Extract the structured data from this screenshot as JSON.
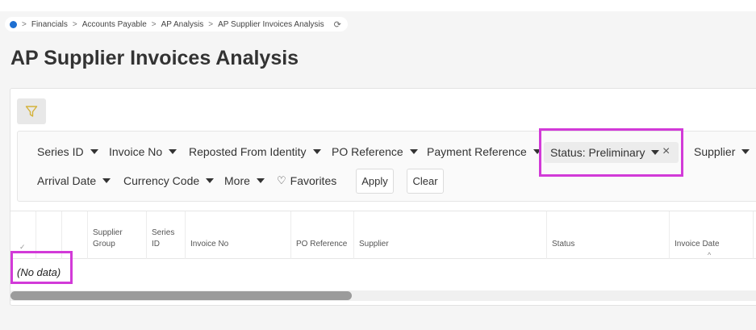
{
  "breadcrumb": {
    "items": [
      "Financials",
      "Accounts Payable",
      "AP Analysis",
      "AP Supplier Invoices Analysis"
    ],
    "separator": ">",
    "refresh_icon": "refresh-icon"
  },
  "page": {
    "title": "AP Supplier Invoices Analysis"
  },
  "filters": {
    "toggle_icon": "funnel-icon",
    "items": [
      "Series ID",
      "Invoice No",
      "Reposted From Identity",
      "PO Reference",
      "Payment Reference",
      "Supplier",
      "Arrival Date",
      "Currency Code",
      "More"
    ],
    "active_filter": {
      "label": "Status: Preliminary",
      "close_glyph": "×"
    },
    "favorites": {
      "icon": "heart-icon",
      "label": "Favorites",
      "glyph": "♡"
    },
    "apply_label": "Apply",
    "clear_label": "Clear"
  },
  "grid": {
    "check_glyph": "✓",
    "columns": [
      "Supplier Group",
      "Series ID",
      "Invoice No",
      "PO Reference",
      "Supplier",
      "Status",
      "Invoice Date"
    ],
    "sort_glyph": "^",
    "empty_text": "(No data)"
  },
  "colors": {
    "highlight": "#d23ad8",
    "accent": "#1f6fd1",
    "filter_icon": "#d4b23a"
  }
}
